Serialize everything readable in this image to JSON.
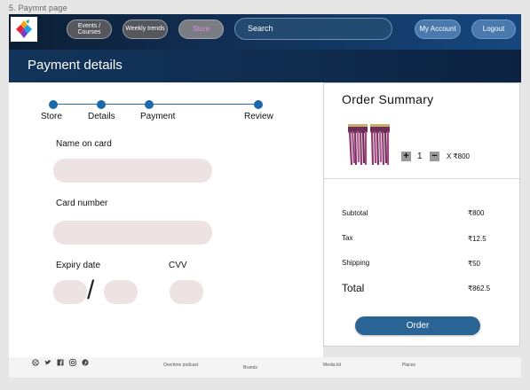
{
  "frame_label": "5. Paymnt page",
  "nav": {
    "events": "Events / Courses",
    "trends": "Weekly trends",
    "store": "Store",
    "search_placeholder": "Search",
    "account": "My Account",
    "logout": "Logout"
  },
  "page_title": "Payment details",
  "steps": [
    "Store",
    "Details",
    "Payment",
    "Review"
  ],
  "form": {
    "name_label": "Name on card",
    "card_label": "Card number",
    "expiry_label": "Expiry date",
    "cvv_label": "CVV",
    "expiry_sep": "/"
  },
  "summary": {
    "title": "Order  Summary",
    "plus": "+",
    "minus": "−",
    "quantity": "1",
    "unit_price": "X ₹800",
    "subtotal_label": "Subtotal",
    "subtotal_value": "₹800",
    "tax_label": "Tax",
    "tax_value": "₹12.5",
    "shipping_label": "Shipping",
    "shipping_value": "₹50",
    "total_label": "Total",
    "total_value": "₹862.5",
    "order_button": "Order"
  },
  "footer": {
    "podcast": "Overtime podcast",
    "brands": "Brands",
    "media_kit": "Media kit",
    "places": "Places"
  },
  "colors": {
    "nav_dark": "#0c1e34",
    "nav_blue": "#16477e",
    "step_blue": "#1b69ad",
    "field_bg": "#ede3e3",
    "order_button": "#2a6494",
    "store_text": "#e58ad8"
  },
  "icons": {
    "logo": "colorful-diamond-logo",
    "social": [
      "dribbble-icon",
      "twitter-icon",
      "facebook-icon",
      "instagram-icon",
      "pinterest-icon"
    ]
  }
}
